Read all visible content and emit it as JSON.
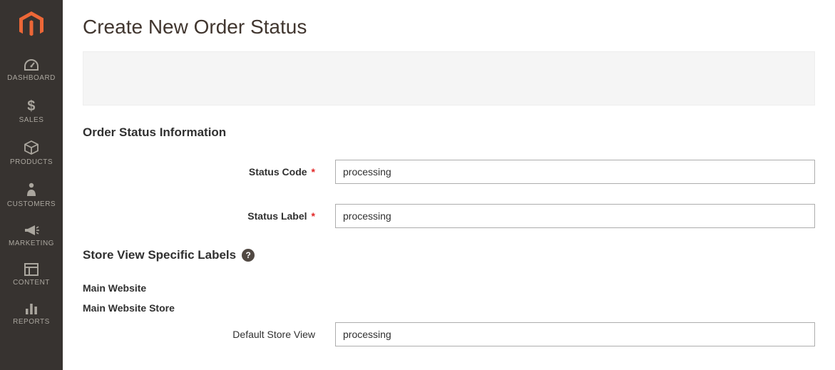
{
  "sidebar": {
    "items": [
      {
        "label": "DASHBOARD"
      },
      {
        "label": "SALES"
      },
      {
        "label": "PRODUCTS"
      },
      {
        "label": "CUSTOMERS"
      },
      {
        "label": "MARKETING"
      },
      {
        "label": "CONTENT"
      },
      {
        "label": "REPORTS"
      }
    ]
  },
  "page": {
    "title": "Create New Order Status"
  },
  "section1": {
    "title": "Order Status Information",
    "status_code_label": "Status Code",
    "status_code_value": "processing",
    "status_label_label": "Status Label",
    "status_label_value": "processing"
  },
  "section2": {
    "title": "Store View Specific Labels",
    "website_label": "Main Website",
    "store_label": "Main Website Store",
    "store_view_label": "Default Store View",
    "store_view_value": "processing"
  }
}
